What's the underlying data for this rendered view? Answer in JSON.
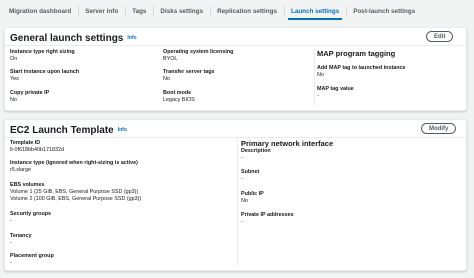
{
  "tabs": [
    {
      "label": "Migration dashboard"
    },
    {
      "label": "Server info"
    },
    {
      "label": "Tags"
    },
    {
      "label": "Disks settings"
    },
    {
      "label": "Replication settings"
    },
    {
      "label": "Launch settings"
    },
    {
      "label": "Post-launch settings"
    }
  ],
  "active_tab": "Launch settings",
  "general": {
    "title": "General launch settings",
    "info": "Info",
    "edit_label": "Edit",
    "fields": {
      "right_sizing": {
        "label": "Instance type right sizing",
        "value": "On"
      },
      "start_instance": {
        "label": "Start instance upon launch",
        "value": "Yes"
      },
      "copy_private_ip": {
        "label": "Copy private IP",
        "value": "No"
      },
      "os_licensing": {
        "label": "Operating system licensing",
        "value": "BYOL"
      },
      "transfer_tags": {
        "label": "Transfer server tags",
        "value": "No"
      },
      "boot_mode": {
        "label": "Boot mode",
        "value": "Legacy BIOS"
      }
    },
    "map": {
      "title": "MAP program tagging",
      "add_tag": {
        "label": "Add MAP tag to launched instance",
        "value": "No"
      },
      "tag_value": {
        "label": "MAP tag value",
        "value": "-"
      }
    }
  },
  "ec2": {
    "title": "EC2 Launch Template",
    "info": "Info",
    "modify_label": "Modify",
    "fields": {
      "template_id": {
        "label": "Template ID",
        "value": "lt-0f618bb40b171832d"
      },
      "instance_type": {
        "label": "Instance type (ignored when right-sizing is active)",
        "value": "r5.xlarge"
      },
      "ebs": {
        "label": "EBS volumes",
        "line1": "Volume 1 (25 GiB, EBS, General Purpose SSD (gp3))",
        "line2": "Volume 2 (100 GiB, EBS, General Purpose SSD (gp3))"
      },
      "security_groups": {
        "label": "Security groups",
        "value": "-"
      },
      "tenancy": {
        "label": "Tenancy",
        "value": "-"
      },
      "placement_group": {
        "label": "Placement group",
        "value": "-"
      }
    },
    "network": {
      "title": "Primary network interface",
      "description": {
        "label": "Description",
        "value": "-"
      },
      "subnet": {
        "label": "Subnet",
        "value": "-"
      },
      "public_ip": {
        "label": "Public IP",
        "value": "No"
      },
      "private_ips": {
        "label": "Private IP addresses",
        "value": "-"
      }
    }
  },
  "colors": {
    "accent": "#0073bb",
    "text": "#16191f",
    "muted": "#545b64",
    "background": "#f2f3f3"
  }
}
